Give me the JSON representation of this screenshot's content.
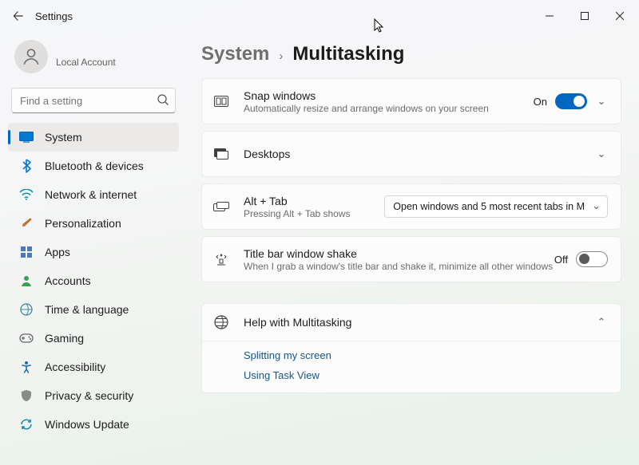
{
  "window": {
    "title": "Settings"
  },
  "profile": {
    "name": "",
    "subtitle": "Local Account"
  },
  "search": {
    "placeholder": "Find a setting"
  },
  "nav": {
    "items": [
      {
        "label": "System"
      },
      {
        "label": "Bluetooth & devices"
      },
      {
        "label": "Network & internet"
      },
      {
        "label": "Personalization"
      },
      {
        "label": "Apps"
      },
      {
        "label": "Accounts"
      },
      {
        "label": "Time & language"
      },
      {
        "label": "Gaming"
      },
      {
        "label": "Accessibility"
      },
      {
        "label": "Privacy & security"
      },
      {
        "label": "Windows Update"
      }
    ]
  },
  "breadcrumb": {
    "parent": "System",
    "current": "Multitasking"
  },
  "rows": {
    "snap": {
      "title": "Snap windows",
      "desc": "Automatically resize and arrange windows on your screen",
      "state_label": "On",
      "state": true
    },
    "desktops": {
      "title": "Desktops"
    },
    "alttab": {
      "title": "Alt + Tab",
      "desc": "Pressing Alt + Tab shows",
      "dropdown": "Open windows and 5 most recent tabs in M"
    },
    "shake": {
      "title": "Title bar window shake",
      "desc": "When I grab a window's title bar and shake it, minimize all other windows",
      "state_label": "Off",
      "state": false
    }
  },
  "help": {
    "title": "Help with Multitasking",
    "links": [
      "Splitting my screen",
      "Using Task View"
    ]
  }
}
